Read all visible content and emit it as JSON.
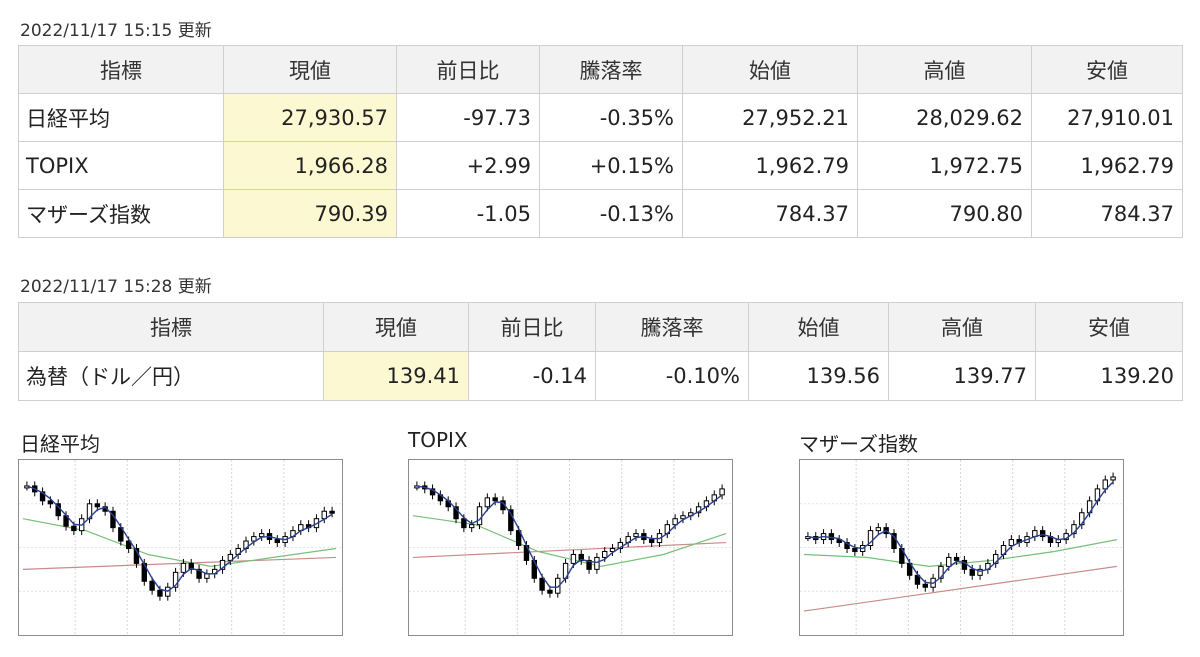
{
  "section1": {
    "timestamp": "2022/11/17 15:15 更新",
    "headers": [
      "指標",
      "現値",
      "前日比",
      "騰落率",
      "始値",
      "高値",
      "安値"
    ],
    "rows": [
      {
        "name": "日経平均",
        "current": "27,930.57",
        "change": "-97.73",
        "rate": "-0.35%",
        "open": "27,952.21",
        "high": "28,029.62",
        "low": "27,910.01",
        "direction": "down"
      },
      {
        "name": "TOPIX",
        "current": "1,966.28",
        "change": "+2.99",
        "rate": "+0.15%",
        "open": "1,962.79",
        "high": "1,972.75",
        "low": "1,962.79",
        "direction": "up"
      },
      {
        "name": "マザーズ指数",
        "current": "790.39",
        "change": "-1.05",
        "rate": "-0.13%",
        "open": "784.37",
        "high": "790.80",
        "low": "784.37",
        "direction": "down"
      }
    ]
  },
  "section2": {
    "timestamp": "2022/11/17 15:28 更新",
    "headers": [
      "指標",
      "現値",
      "前日比",
      "騰落率",
      "始値",
      "高値",
      "安値"
    ],
    "rows": [
      {
        "name": "為替（ドル／円）",
        "current": "139.41",
        "change": "-0.14",
        "rate": "-0.10%",
        "open": "139.56",
        "high": "139.77",
        "low": "139.20",
        "direction": "down"
      }
    ]
  },
  "charts": {
    "titles": [
      "日経平均",
      "TOPIX",
      "マザーズ指数"
    ]
  },
  "colors": {
    "link": "#1f5fbf",
    "negative": "#1c4fd0",
    "positive": "#e1251b",
    "current_bg": "#fbf8d2",
    "header_bg": "#f2f2f2",
    "ma_short": "#2a3f8f",
    "ma_mid": "#77c077",
    "ma_long": "#c98a8a"
  }
}
